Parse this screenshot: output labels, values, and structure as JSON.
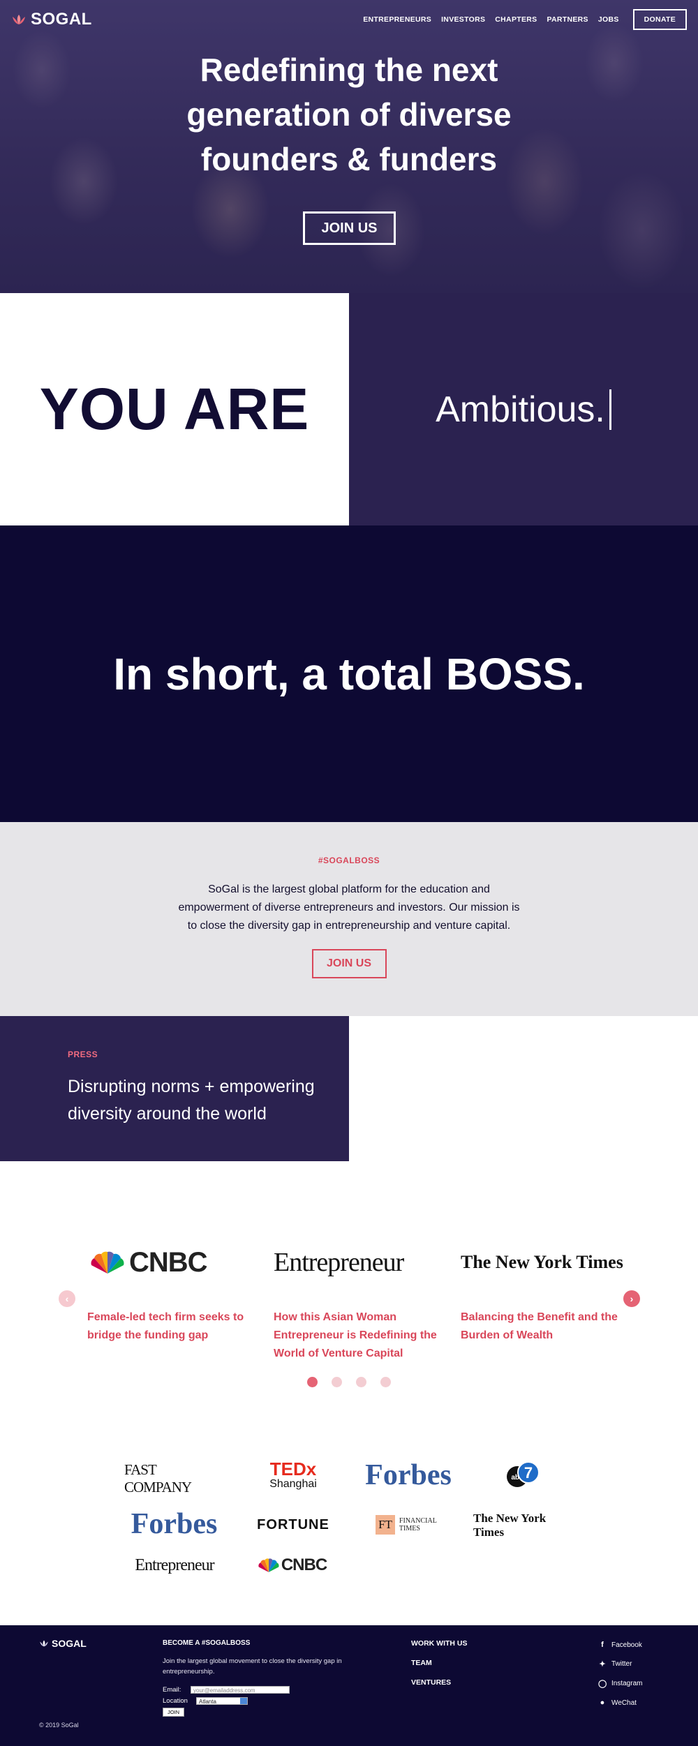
{
  "nav": {
    "logo_text": "SOGAL",
    "links": [
      "ENTREPRENEURS",
      "INVESTORS",
      "CHAPTERS",
      "PARTNERS",
      "JOBS"
    ],
    "donate_label": "DONATE"
  },
  "hero": {
    "title_lines": [
      "Redefining the next",
      "generation of diverse",
      "founders & funders"
    ],
    "join_label": "JOIN US"
  },
  "youare": {
    "left_text": "YOU ARE",
    "right_text": "Ambitious."
  },
  "boss": {
    "text": "In short, a total BOSS."
  },
  "mission": {
    "tag": "#SOGALBOSS",
    "text": "SoGal is the largest global platform for the education and empowerment of diverse entrepreneurs and investors. Our mission is to close the diversity gap in entrepreneurship and venture capital.",
    "join_label": "JOIN US"
  },
  "press": {
    "tag": "PRESS",
    "heading": "Disrupting norms + empowering diversity around the world"
  },
  "carousel": {
    "cards": [
      {
        "logo": "CNBC",
        "title": "Female-led tech firm seeks to bridge the funding gap"
      },
      {
        "logo": "Entrepreneur",
        "title": "How this Asian Woman Entrepreneur is Redefining the World of Venture Capital"
      },
      {
        "logo": "The New York Times",
        "title": "Balancing the Benefit and the Burden of Wealth"
      }
    ],
    "prev_icon": "chevron-left-icon",
    "next_icon": "chevron-right-icon",
    "slide_count": 4,
    "active_slide": 1
  },
  "logowall": {
    "fastcompany": "FAST COMPANY",
    "tedx": "TEDx",
    "tedx_sub": "Shanghai",
    "forbes": "Forbes",
    "abc": "abc7",
    "fortune": "FORTUNE",
    "ft_mark": "FT",
    "ft_text": "FINANCIAL TIMES",
    "nyt": "The New York Times",
    "entrepreneur": "Entrepreneur",
    "cnbc": "CNBC"
  },
  "footer": {
    "logo_text": "SOGAL",
    "copyright": "© 2019 SoGal",
    "become_title": "BECOME A #SOGALBOSS",
    "become_desc": "Join the largest global movement to close the diversity gap in entrepreneurship.",
    "email_label": "Email:",
    "email_placeholder": "your@emailaddress.com",
    "location_label": "Location",
    "location_value": "Atlanta",
    "join_label": "JOIN",
    "links": [
      "WORK WITH US",
      "TEAM",
      "VENTURES"
    ],
    "social": [
      {
        "icon": "facebook-icon",
        "label": "Facebook"
      },
      {
        "icon": "twitter-icon",
        "label": "Twitter"
      },
      {
        "icon": "instagram-icon",
        "label": "Instagram"
      },
      {
        "icon": "wechat-icon",
        "label": "WeChat"
      }
    ]
  },
  "colors": {
    "navy": "#0d0933",
    "purple": "#2b2250",
    "accent": "#d9475a",
    "light_grey": "#e6e5e8"
  }
}
